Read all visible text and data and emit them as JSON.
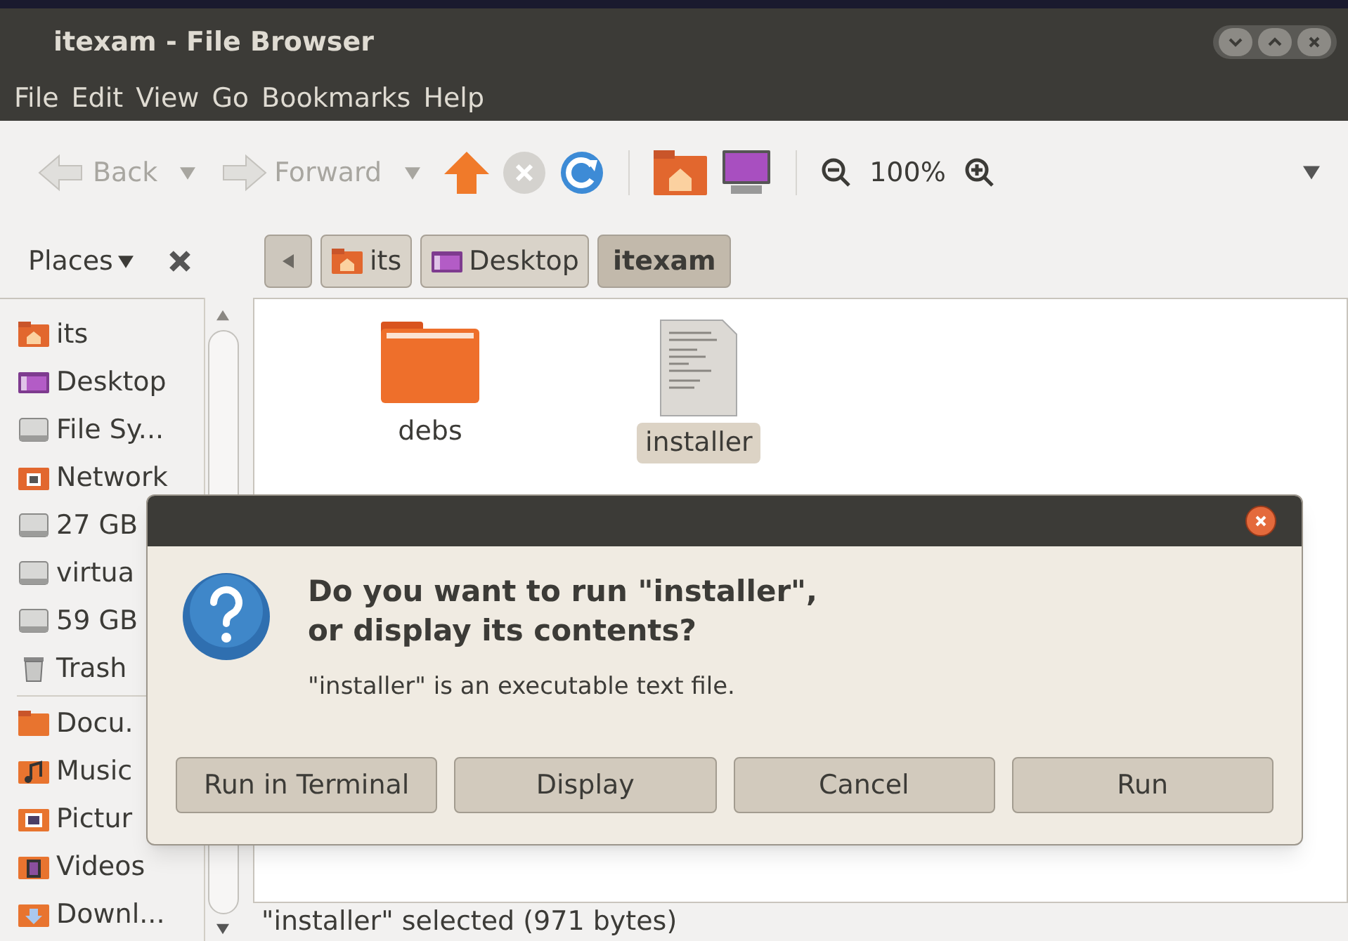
{
  "window": {
    "title": "itexam - File Browser"
  },
  "menu": [
    "File",
    "Edit",
    "View",
    "Go",
    "Bookmarks",
    "Help"
  ],
  "toolbar": {
    "back": {
      "label": "Back",
      "disabled": true
    },
    "forward": {
      "label": "Forward",
      "disabled": true
    },
    "zoom": "100%"
  },
  "places": {
    "label": "Places"
  },
  "breadcrumbs": [
    {
      "label": "its",
      "kind": "home",
      "selected": false
    },
    {
      "label": "Desktop",
      "kind": "desktop",
      "selected": false
    },
    {
      "label": "itexam",
      "kind": "none",
      "selected": true
    }
  ],
  "sidebar": {
    "sections": [
      [
        {
          "label": "its",
          "kind": "home"
        },
        {
          "label": "Desktop",
          "kind": "desktop"
        },
        {
          "label": "File Sy...",
          "kind": "drive"
        },
        {
          "label": "Network",
          "kind": "network"
        },
        {
          "label": "27 GB",
          "kind": "drive"
        },
        {
          "label": "virtua",
          "kind": "drive"
        },
        {
          "label": "59 GB",
          "kind": "drive"
        },
        {
          "label": "Trash",
          "kind": "trash"
        }
      ],
      [
        {
          "label": "Docu.",
          "kind": "folder"
        },
        {
          "label": "Music",
          "kind": "music"
        },
        {
          "label": "Pictur",
          "kind": "pictures"
        },
        {
          "label": "Videos",
          "kind": "videos"
        },
        {
          "label": "Downl...",
          "kind": "downloads"
        }
      ]
    ]
  },
  "files": [
    {
      "name": "debs",
      "kind": "folder",
      "selected": false
    },
    {
      "name": "installer",
      "kind": "text",
      "selected": true
    }
  ],
  "status_bar": "\"installer\" selected (971 bytes)",
  "dialog": {
    "heading": "Do you want to run \"installer\",\nor display its contents?",
    "message": "\"installer\" is an executable text file.",
    "buttons": [
      "Run in Terminal",
      "Display",
      "Cancel",
      "Run"
    ]
  }
}
